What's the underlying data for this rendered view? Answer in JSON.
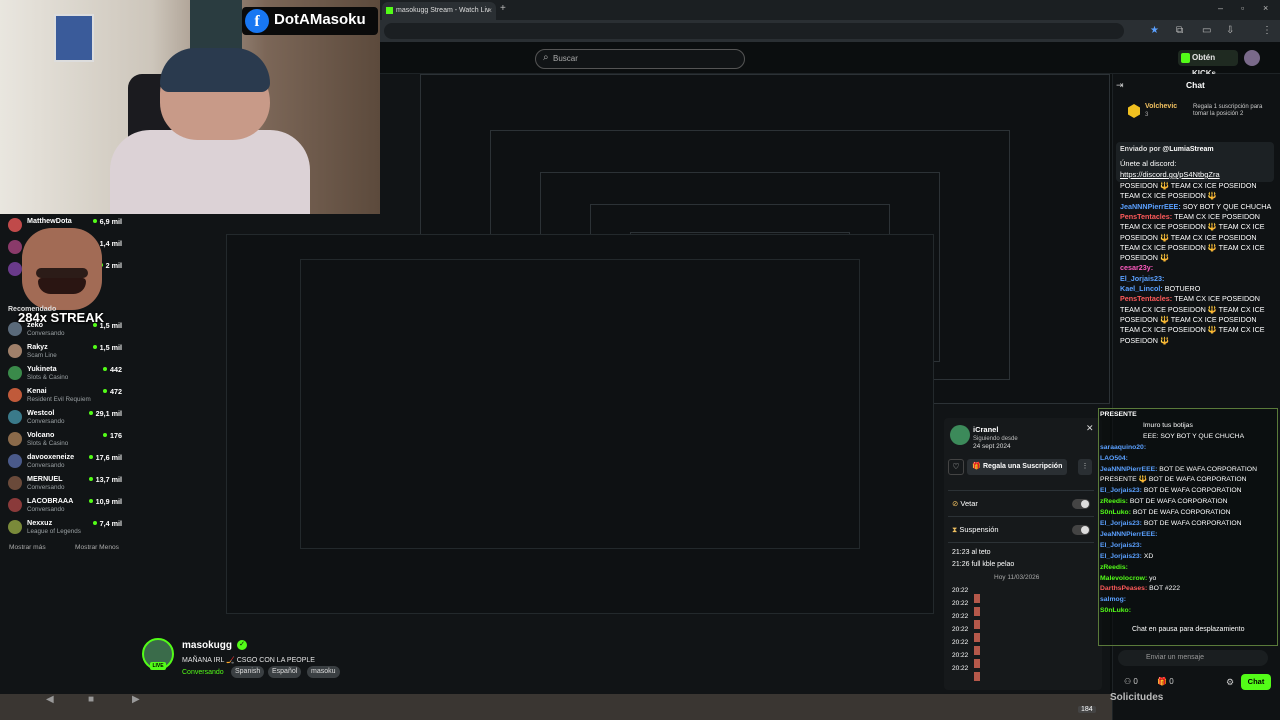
{
  "browser": {
    "tab_title": "masokugg Stream - Watch Liv",
    "close_tab": "×",
    "new_tab": "+"
  },
  "header": {
    "search_placeholder": "Buscar",
    "obtain_label": "Obtén KICKs"
  },
  "webcam": {
    "facebook_handle": "DotAMasoku",
    "fb_glyph": "f"
  },
  "sidebar": {
    "recommended_title": "Recomendado",
    "top_items": [
      {
        "name": "MatthewDota",
        "count": "6,9 mil",
        "category": ""
      },
      {
        "name": "",
        "count": "1,4 mil",
        "category": ""
      },
      {
        "name": "",
        "count": "2 mil",
        "category": ""
      }
    ],
    "items": [
      {
        "name": "zeko",
        "category": "Conversando",
        "count": "1,5 mil"
      },
      {
        "name": "Rakyz",
        "category": "Scam Line",
        "count": "1,5 mil"
      },
      {
        "name": "Yukineta",
        "category": "Slots & Casino",
        "count": "442"
      },
      {
        "name": "Kenai",
        "category": "Resident Evil Requiem",
        "count": "472"
      },
      {
        "name": "Westcol",
        "category": "Conversando",
        "count": "29,1 mil"
      },
      {
        "name": "Volcano",
        "category": "Slots & Casino",
        "count": "176"
      },
      {
        "name": "davooxeneize",
        "category": "Conversando",
        "count": "17,6 mil"
      },
      {
        "name": "MERNUEL",
        "category": "Conversando",
        "count": "13,7 mil"
      },
      {
        "name": "LACOBRAAA",
        "category": "Conversando",
        "count": "10,9 mil"
      },
      {
        "name": "Nexxuz",
        "category": "League of Legends",
        "count": "7,4 mil"
      }
    ],
    "show_more": "Mostrar más",
    "show_less": "Mostrar Menos",
    "streak": "284x STREAK"
  },
  "stream": {
    "channel": "masokugg",
    "live": "LIVE",
    "title": "MAÑANA IRL 🏒 CSGO CON LA PEOPLE",
    "category": "Conversando",
    "tags": [
      "Spanish",
      "Español",
      "masoku"
    ]
  },
  "user_card": {
    "username": "iCranel",
    "following_label": "Siguiendo desde",
    "following_date": "24 sept 2024",
    "gift_label": "Regala una Suscripción",
    "veto_label": "Vetar",
    "suspend_label": "Suspensión",
    "messages": [
      {
        "time": "21:23",
        "text": "al teto"
      },
      {
        "time": "21:26",
        "text": "full kble pelao"
      }
    ],
    "date_divider": "Hoy 11/03/2026",
    "times": [
      "20:22",
      "20:22",
      "20:22",
      "20:22",
      "20:22",
      "20:22",
      "20:22"
    ]
  },
  "chat": {
    "title": "Chat",
    "pinned_user": "Volchevic",
    "pinned_rank": "3",
    "pinned_prompt": "Regala 1 suscripción para tomar la posición 2",
    "pin_by_label": "Enviado por",
    "pin_by_user": "@LumiaStream",
    "pin_message": "Únete al discord:",
    "pin_link": "https://discord.gg/pS4NtbgZra",
    "lines": [
      {
        "user": "",
        "text": "POSEIDON 🔱 TEAM CX ICE POSEIDON",
        "color": "#ffffff"
      },
      {
        "user": "",
        "text": "TEAM CX ICE POSEIDON 🔱",
        "color": "#ffffff"
      },
      {
        "user": "JeaNNNPierrEEE:",
        "text": " SOY BOT Y QUE CHUCHA",
        "color": "#5aa0ff"
      },
      {
        "user": "PensTentacles:",
        "text": " TEAM CX ICE POSEIDON",
        "color": "#ff5a5a"
      },
      {
        "user": "",
        "text": "TEAM CX ICE POSEIDON 🔱 TEAM CX ICE",
        "color": "#ffffff"
      },
      {
        "user": "",
        "text": "POSEIDON 🔱 TEAM CX ICE POSEIDON",
        "color": "#ffffff"
      },
      {
        "user": "",
        "text": "TEAM CX ICE POSEIDON 🔱 TEAM CX ICE",
        "color": "#ffffff"
      },
      {
        "user": "",
        "text": "POSEIDON 🔱",
        "color": "#ffffff"
      },
      {
        "user": "cesar23y:",
        "text": "",
        "color": "#ff5ac0"
      },
      {
        "user": "El_Jorjais23:",
        "text": "",
        "color": "#5aa0ff"
      },
      {
        "user": "Kael_Lincol:",
        "text": " BOTUERO",
        "color": "#5aa0ff"
      },
      {
        "user": "PensTentacles:",
        "text": " TEAM CX ICE POSEIDON",
        "color": "#ff5a5a"
      },
      {
        "user": "",
        "text": "TEAM CX ICE POSEIDON 🔱 TEAM CX ICE",
        "color": "#ffffff"
      },
      {
        "user": "",
        "text": "POSEIDON 🔱 TEAM CX ICE POSEIDON",
        "color": "#ffffff"
      },
      {
        "user": "",
        "text": "TEAM CX ICE POSEIDON 🔱 TEAM CX ICE",
        "color": "#ffffff"
      },
      {
        "user": "",
        "text": "POSEIDON 🔱",
        "color": "#ffffff"
      }
    ],
    "input_placeholder": "Enviar un mensaje",
    "send_label": "Chat",
    "points": "0",
    "gifts": "0"
  },
  "overlay": {
    "lines": [
      {
        "user": "PRESENTE",
        "text": "",
        "color": "#ffffff"
      },
      {
        "user": "",
        "text": "Imuro tus botijas",
        "color": "#ffffff"
      },
      {
        "user": "",
        "text": "EEE: SOY BOT Y QUE CHUCHA",
        "color": "#ffffff"
      },
      {
        "user": "saraaquino20:",
        "text": "",
        "color": "#5aa0ff"
      },
      {
        "user": "LAO504:",
        "text": "",
        "color": "#5aa0ff"
      },
      {
        "user": "JeaNNNPierrEEE:",
        "text": " BOT DE WAFA CORPORATION",
        "color": "#5aa0ff"
      },
      {
        "user": "",
        "text": "PRESENTE 🔱 BOT DE WAFA CORPORATION",
        "color": "#ffffff"
      },
      {
        "user": "El_Jorjais23:",
        "text": " BOT DE WAFA CORPORATION",
        "color": "#5aa0ff"
      },
      {
        "user": "zReedis:",
        "text": " BOT DE WAFA CORPORATION",
        "color": "#53fc18"
      },
      {
        "user": "S0nLuko:",
        "text": " BOT DE WAFA CORPORATION",
        "color": "#53fc18"
      },
      {
        "user": "El_Jorjais23:",
        "text": " BOT DE WAFA CORPORATION",
        "color": "#5aa0ff"
      },
      {
        "user": "JeaNNNPierrEEE:",
        "text": "",
        "color": "#5aa0ff"
      },
      {
        "user": "El_Jorjais23:",
        "text": "",
        "color": "#5aa0ff"
      },
      {
        "user": "El_Jorjais23:",
        "text": " XD",
        "color": "#5aa0ff"
      },
      {
        "user": "zReedis:",
        "text": "",
        "color": "#53fc18"
      },
      {
        "user": "Malevolocrow:",
        "text": " yo",
        "color": "#53fc18"
      },
      {
        "user": "DarthsPeases:",
        "text": " BOT #222",
        "color": "#ff5a5a"
      },
      {
        "user": "salmog:",
        "text": "",
        "color": "#5aa0ff"
      },
      {
        "user": "S0nLuko:",
        "text": "",
        "color": "#53fc18"
      }
    ],
    "paused": "Chat en pausa para desplazamiento",
    "solicitudes": "Solicitudes",
    "count": "184"
  }
}
